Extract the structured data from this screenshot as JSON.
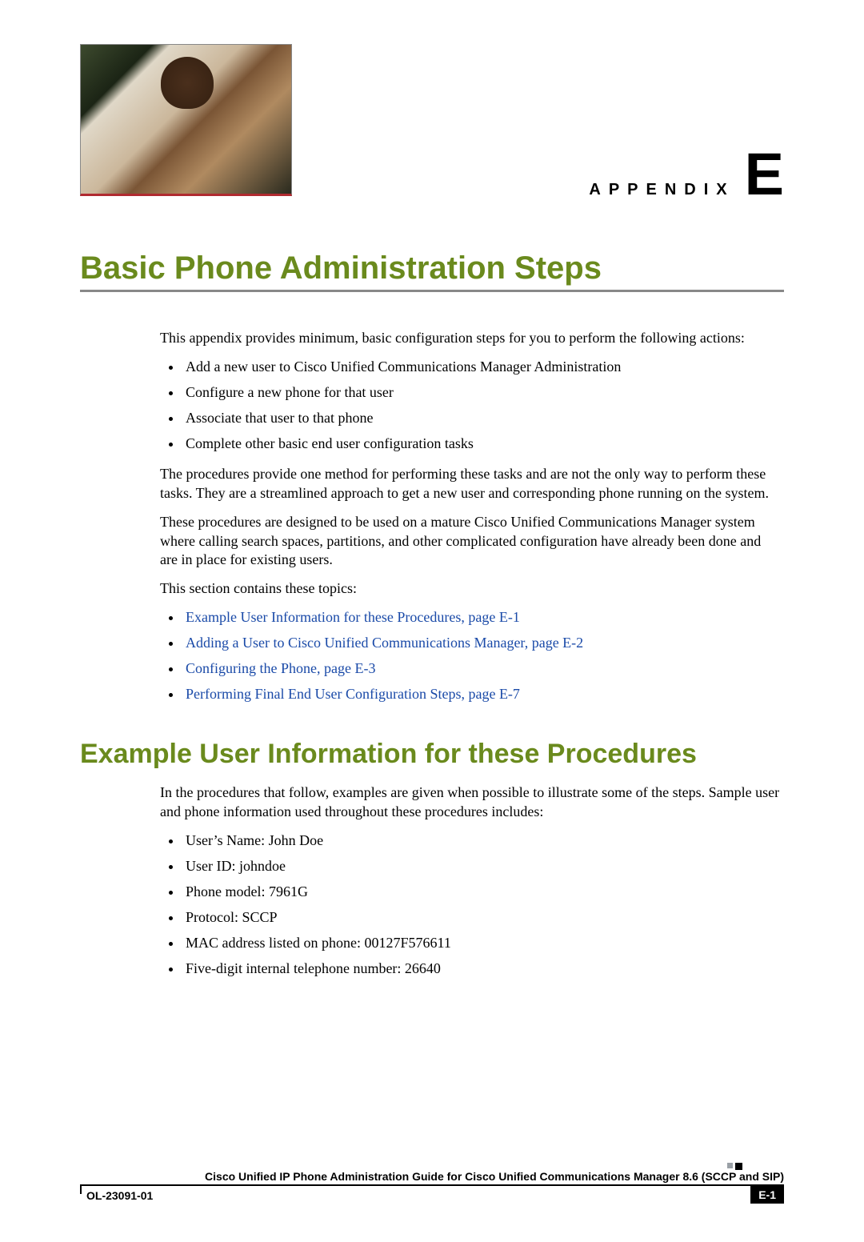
{
  "appendix": {
    "label": "APPENDIX",
    "letter": "E"
  },
  "title": "Basic Phone Administration Steps",
  "p_intro": "This appendix provides minimum, basic configuration steps for you to perform the following actions:",
  "actions": [
    "Add a new user to Cisco Unified Communications Manager Administration",
    "Configure a new phone for that user",
    "Associate that user to that phone",
    "Complete other basic end user configuration tasks"
  ],
  "p_method": "The procedures provide one method for performing these tasks and are not the only way to perform these tasks. They are a streamlined approach to get a new user and corresponding phone running on the system.",
  "p_mature": "These procedures are designed to be used on a mature Cisco Unified Communications Manager system where calling search spaces, partitions, and other complicated configuration have already been done and are in place for existing users.",
  "p_topics": "This section contains these topics:",
  "topics": [
    "Example User Information for these Procedures, page E-1",
    "Adding a User to Cisco Unified Communications Manager, page E-2",
    "Configuring the Phone, page E-3",
    "Performing Final End User Configuration Steps, page E-7"
  ],
  "h2": "Example User Information for these Procedures",
  "p_example": "In the procedures that follow, examples are given when possible to illustrate some of the steps. Sample user and phone information used throughout these procedures includes:",
  "userinfo": [
    "User’s Name: John Doe",
    "User ID: johndoe",
    "Phone model: 7961G",
    "Protocol: SCCP",
    "MAC address listed on phone: 00127F576611",
    "Five-digit internal telephone number: 26640"
  ],
  "footer": {
    "guide_title": "Cisco Unified IP Phone Administration Guide for Cisco Unified Communications Manager 8.6 (SCCP and SIP)",
    "doc_id": "OL-23091-01",
    "page": "E-1"
  }
}
